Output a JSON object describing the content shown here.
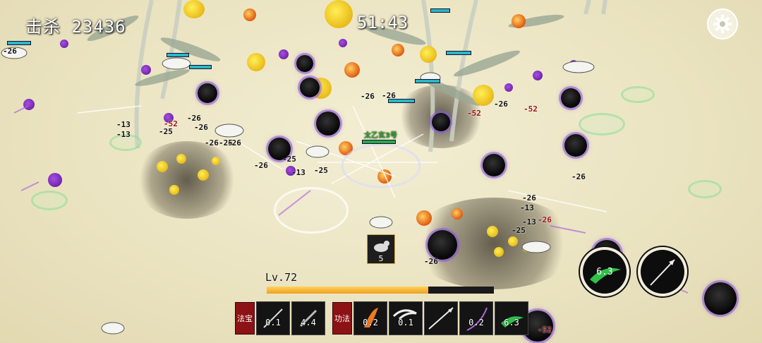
{
  "hud": {
    "kills": "击杀 23436",
    "timer": "51:43",
    "level": "Lv.72",
    "xp_fraction": 0.71,
    "settings_icon": "gear-icon"
  },
  "hero": {
    "name": "太乙玄3号"
  },
  "summon": {
    "count": "5"
  },
  "skillbar": {
    "badges": [
      "法宝",
      "功法"
    ],
    "slots": [
      {
        "cooldown": "0.1",
        "icon": "sword-icon"
      },
      {
        "cooldown": "4.4",
        "icon": "blade-icon"
      },
      {
        "cooldown": "0.2",
        "icon": "flame-icon"
      },
      {
        "cooldown": "0.1",
        "icon": "dragon-icon"
      },
      {
        "cooldown": "",
        "icon": "spear-icon"
      },
      {
        "cooldown": "0.2",
        "icon": "slash-icon"
      },
      {
        "cooldown": "6.3",
        "icon": "jade-dragon-icon"
      }
    ]
  },
  "big_skills": [
    {
      "cooldown": "6.3",
      "icon": "jade-dragon-icon"
    },
    {
      "cooldown": "",
      "icon": "spear-icon"
    }
  ],
  "damage_numbers": [
    "-26",
    "-13",
    "-13",
    "-25",
    "-26",
    "-52",
    "-26",
    "-26",
    "-25",
    "-26",
    "-26",
    "-13",
    "-25",
    "-25",
    "-26",
    "-26",
    "-52",
    "-26",
    "-52",
    "-26",
    "-13",
    "-26",
    "-13",
    "-25",
    "-26",
    "-52",
    "-26"
  ],
  "colors": {
    "accent_red": "#8c1216",
    "xp": "#f0a020",
    "enemy_hp": "#2ab6c8",
    "void_orb": "#050505",
    "purple_orb": "#7a2ab8"
  }
}
